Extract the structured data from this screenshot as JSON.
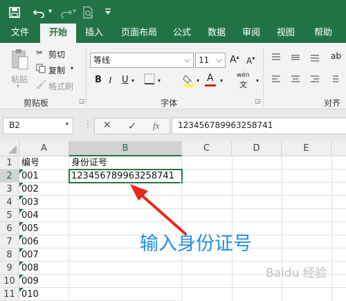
{
  "qat": {
    "save_icon": "save-icon",
    "undo_icon": "undo-icon",
    "redo_icon": "redo-icon",
    "preview_icon": "print-preview-icon",
    "more_icon": "customize-qat-icon"
  },
  "tabs": [
    "文件",
    "开始",
    "插入",
    "页面布局",
    "公式",
    "数据",
    "审阅",
    "视图",
    "帮助"
  ],
  "active_tab": "开始",
  "clipboard": {
    "paste": "粘贴",
    "cut": "剪切",
    "copy": "复制",
    "format_painter": "格式刷",
    "group": "剪贴板"
  },
  "font": {
    "name": "等线",
    "size": "11",
    "grow": "A",
    "shrink": "A",
    "bold": "B",
    "italic": "I",
    "underline": "U",
    "font_color": "A",
    "phonetic": "wén",
    "phonetic_sub": "文",
    "group": "字体"
  },
  "alignment": {
    "group": "对齐方"
  },
  "formula_bar": {
    "name_box": "B2",
    "cancel": "✕",
    "enter": "✓",
    "fx": "fx",
    "content": "123456789963258741"
  },
  "columns": [
    "A",
    "B",
    "C",
    "D",
    "E"
  ],
  "rows": [
    "1",
    "2",
    "3",
    "4",
    "5",
    "6",
    "7",
    "8",
    "9",
    "10",
    "11"
  ],
  "cells": {
    "A": [
      "编号",
      "001",
      "002",
      "003",
      "004",
      "005",
      "006",
      "007",
      "008",
      "009",
      "010"
    ],
    "B1": "身份证号",
    "B2": "123456789963258741"
  },
  "active_cell": "B2",
  "annotation": "输入身份证号",
  "watermark": "Baidu 经验",
  "colors": {
    "brand": "#217346",
    "annotation": "#1f8fe6",
    "arrow": "#e8271c"
  }
}
